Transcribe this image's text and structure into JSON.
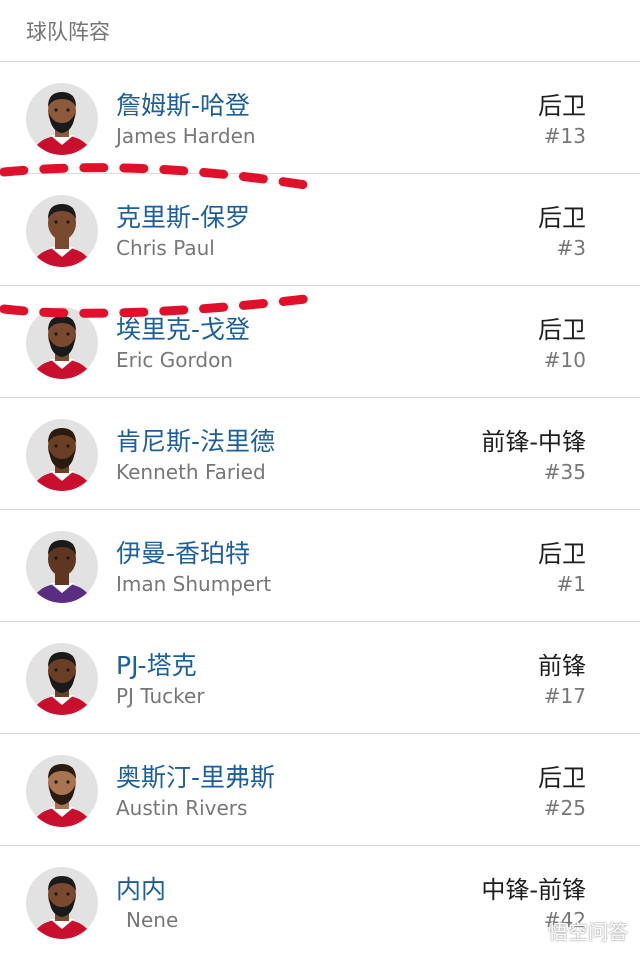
{
  "header": {
    "title": "球队阵容"
  },
  "players": [
    {
      "name_cn": "詹姆斯-哈登",
      "name_en": "James Harden",
      "position": "后卫",
      "number": "#13",
      "jersey_color": "#c8102e",
      "hair": "#1a1a1a",
      "beard": true,
      "skin": "#8d5a3b"
    },
    {
      "name_cn": "克里斯-保罗",
      "name_en": "Chris Paul",
      "position": "后卫",
      "number": "#3",
      "jersey_color": "#c8102e",
      "hair": "#1a1a1a",
      "beard": false,
      "skin": "#7a4a30"
    },
    {
      "name_cn": "埃里克-戈登",
      "name_en": "Eric Gordon",
      "position": "后卫",
      "number": "#10",
      "jersey_color": "#c8102e",
      "hair": "#1a1a1a",
      "beard": true,
      "skin": "#7a4a30"
    },
    {
      "name_cn": "肯尼斯-法里德",
      "name_en": "Kenneth Faried",
      "position": "前锋-中锋",
      "number": "#35",
      "jersey_color": "#c8102e",
      "hair": "#2a1a10",
      "beard": true,
      "skin": "#6b3e26"
    },
    {
      "name_cn": "伊曼-香珀特",
      "name_en": "Iman Shumpert",
      "position": "后卫",
      "number": "#1",
      "jersey_color": "#5a2d82",
      "hair": "#1a1a1a",
      "beard": false,
      "skin": "#5e3621"
    },
    {
      "name_cn": "PJ-塔克",
      "name_en": "PJ Tucker",
      "position": "前锋",
      "number": "#17",
      "jersey_color": "#c8102e",
      "hair": "#1a1a1a",
      "beard": true,
      "skin": "#6b3e26"
    },
    {
      "name_cn": "奥斯汀-里弗斯",
      "name_en": "Austin Rivers",
      "position": "后卫",
      "number": "#25",
      "jersey_color": "#c8102e",
      "hair": "#2a1a10",
      "beard": true,
      "skin": "#a87452"
    },
    {
      "name_cn": "内内",
      "name_en": "Nene",
      "position": "中锋-前锋",
      "number": "#42",
      "jersey_color": "#c8102e",
      "hair": "#1a1a1a",
      "beard": true,
      "skin": "#7a4a30"
    }
  ],
  "annotation": {
    "color": "#e0102a",
    "style": "dashed"
  },
  "watermark": {
    "text": "悟空问答",
    "icon": "wukong-logo-icon"
  }
}
